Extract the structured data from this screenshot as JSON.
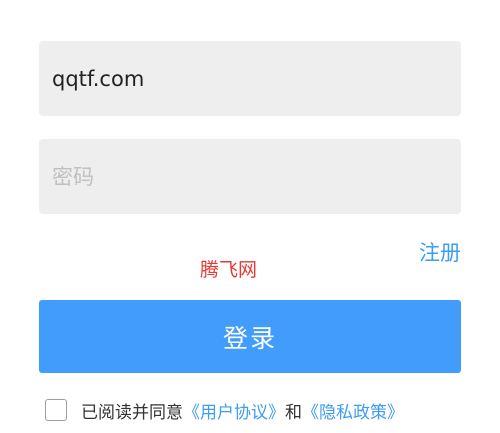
{
  "login_form": {
    "username_value": "qqtf.com",
    "password_placeholder": "密码",
    "register_label": "注册",
    "site_label": "腾飞网",
    "login_button_label": "登录"
  },
  "agreement": {
    "checked": false,
    "prefix_text": "已阅读并同意",
    "user_agreement_link": "《用户协议》",
    "conjunction_text": "和",
    "privacy_policy_link": "《隐私政策》"
  },
  "colors": {
    "field_background": "#eeeeee",
    "accent_blue": "#419cfb",
    "link_blue": "#3d9cf3",
    "site_label_red": "#e53935"
  }
}
